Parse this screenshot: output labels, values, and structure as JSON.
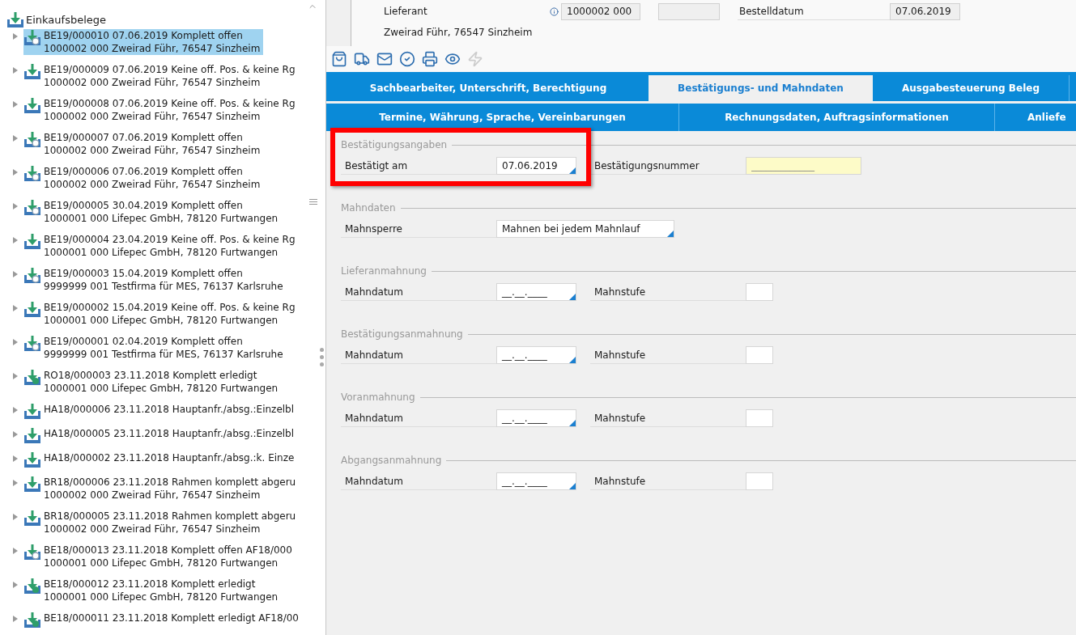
{
  "tree": {
    "root": "Einkaufsbelege",
    "items": [
      {
        "line1": "BE19/000010 07.06.2019 Komplett offen",
        "line2": "1000002 000 Zweirad Führ, 76547 Sinzheim",
        "kind": "open",
        "selected": true
      },
      {
        "line1": "BE19/000009 07.06.2019 Keine off. Pos. & keine Rg",
        "line2": "1000002 000 Zweirad Führ, 76547 Sinzheim",
        "kind": "plain",
        "selected": false
      },
      {
        "line1": "BE19/000008 07.06.2019 Keine off. Pos. & keine Rg",
        "line2": "1000002 000 Zweirad Führ, 76547 Sinzheim",
        "kind": "plain",
        "selected": false
      },
      {
        "line1": "BE19/000007 07.06.2019 Komplett offen",
        "line2": "1000002 000 Zweirad Führ, 76547 Sinzheim",
        "kind": "open",
        "selected": false
      },
      {
        "line1": "BE19/000006 07.06.2019 Komplett offen",
        "line2": "1000002 000 Zweirad Führ, 76547 Sinzheim",
        "kind": "open",
        "selected": false
      },
      {
        "line1": "BE19/000005 30.04.2019 Komplett offen",
        "line2": "1000001 000 Lifepec GmbH, 78120 Furtwangen",
        "kind": "open",
        "selected": false
      },
      {
        "line1": "BE19/000004 23.04.2019 Keine off. Pos. & keine Rg",
        "line2": "1000001 000 Lifepec GmbH, 78120 Furtwangen",
        "kind": "plain",
        "selected": false
      },
      {
        "line1": "BE19/000003 15.04.2019 Komplett offen",
        "line2": "9999999 001 Testfirma für MES, 76137 Karlsruhe",
        "kind": "open",
        "selected": false
      },
      {
        "line1": "BE19/000002 15.04.2019 Keine off. Pos. & keine Rg",
        "line2": "1000001 000 Lifepec GmbH, 78120 Furtwangen",
        "kind": "plain",
        "selected": false
      },
      {
        "line1": "BE19/000001 02.04.2019 Komplett offen",
        "line2": "9999999 001 Testfirma für MES, 76137 Karlsruhe",
        "kind": "open",
        "selected": false
      },
      {
        "line1": "RO18/000003 23.11.2018 Komplett erledigt",
        "line2": "1000001 000 Lifepec GmbH, 78120 Furtwangen",
        "kind": "done",
        "selected": false
      },
      {
        "line1": "HA18/000006 23.11.2018 Hauptanfr./absg.:Einzelbl",
        "kind": "plain",
        "selected": false
      },
      {
        "line1": "HA18/000005 23.11.2018 Hauptanfr./absg.:Einzelbl",
        "kind": "plain",
        "selected": false
      },
      {
        "line1": "HA18/000002 23.11.2018 Hauptanfr./absg.:k. Einze",
        "kind": "plain",
        "selected": false
      },
      {
        "line1": "BR18/000006 23.11.2018 Rahmen komplett abgeru",
        "line2": "1000002 000 Zweirad Führ, 76547 Sinzheim",
        "kind": "plain",
        "selected": false
      },
      {
        "line1": "BR18/000005 23.11.2018 Rahmen komplett abgeru",
        "line2": "1000002 000 Zweirad Führ, 76547 Sinzheim",
        "kind": "plain",
        "selected": false
      },
      {
        "line1": "BE18/000013 23.11.2018 Komplett offen AF18/000",
        "line2": "1000001 000 Lifepec GmbH, 78120 Furtwangen",
        "kind": "open",
        "selected": false
      },
      {
        "line1": "BE18/000012 23.11.2018 Komplett erledigt",
        "line2": "1000001 000 Lifepec GmbH, 78120 Furtwangen",
        "kind": "done",
        "selected": false
      },
      {
        "line1": "BE18/000011 23.11.2018 Komplett erledigt AF18/00",
        "kind": "done",
        "selected": false
      }
    ]
  },
  "header": {
    "supplier_label": "Lieferant",
    "supplier_number": "1000002 000",
    "order_date_label": "Bestelldatum",
    "order_date": "07.06.2019",
    "supplier_address": "Zweirad Führ, 76547 Sinzheim"
  },
  "toolbar": [
    {
      "kind": "bag",
      "disabled": false
    },
    {
      "kind": "truck",
      "disabled": false
    },
    {
      "kind": "mail",
      "disabled": false
    },
    {
      "kind": "check",
      "disabled": false
    },
    {
      "kind": "printer",
      "disabled": false
    },
    {
      "kind": "preview",
      "disabled": false
    },
    {
      "kind": "flash",
      "disabled": true
    }
  ],
  "tabs_row1": [
    {
      "label": "Sachbearbeiter, Unterschrift, Berechtigung",
      "selected": false
    },
    {
      "label": "Bestätigungs- und Mahndaten",
      "selected": true
    },
    {
      "label": "Ausgabesteuerung Beleg",
      "selected": false
    }
  ],
  "tabs_row2": [
    {
      "label": "Termine, Währung, Sprache, Vereinbarungen",
      "selected": false
    },
    {
      "label": "Rechnungsdaten, Auftragsinformationen",
      "selected": false
    },
    {
      "label": "Anliefe",
      "selected": false
    }
  ],
  "sections": [
    {
      "title": "Bestätigungsangaben",
      "highlighted": true,
      "fields": [
        {
          "label": "Bestätigt am",
          "value": "07.06.2019",
          "kind": "date"
        },
        {
          "label": "Bestätigungsnummer",
          "placeholder": "_____________",
          "kind": "required"
        }
      ]
    },
    {
      "title": "Mahndaten",
      "highlighted": false,
      "fields": [
        {
          "label": "Mahnsperre",
          "value": "Mahnen bei jedem Mahnlauf",
          "kind": "dropdown"
        }
      ]
    },
    {
      "title": "Lieferanmahnung",
      "highlighted": false,
      "fields": [
        {
          "label": "Mahndatum",
          "value": "__.__.____",
          "kind": "date"
        },
        {
          "label": "Mahnstufe",
          "kind": "small"
        }
      ]
    },
    {
      "title": "Bestätigungsanmahnung",
      "highlighted": false,
      "fields": [
        {
          "label": "Mahndatum",
          "value": "__.__.____",
          "kind": "date"
        },
        {
          "label": "Mahnstufe",
          "kind": "small"
        }
      ]
    },
    {
      "title": "Voranmahnung",
      "highlighted": false,
      "fields": [
        {
          "label": "Mahndatum",
          "value": "__.__.____",
          "kind": "date"
        },
        {
          "label": "Mahnstufe",
          "kind": "small"
        }
      ]
    },
    {
      "title": "Abgangsanmahnung",
      "highlighted": false,
      "fields": [
        {
          "label": "Mahndatum",
          "value": "__.__.____",
          "kind": "date"
        },
        {
          "label": "Mahnstufe",
          "kind": "small"
        }
      ]
    }
  ]
}
